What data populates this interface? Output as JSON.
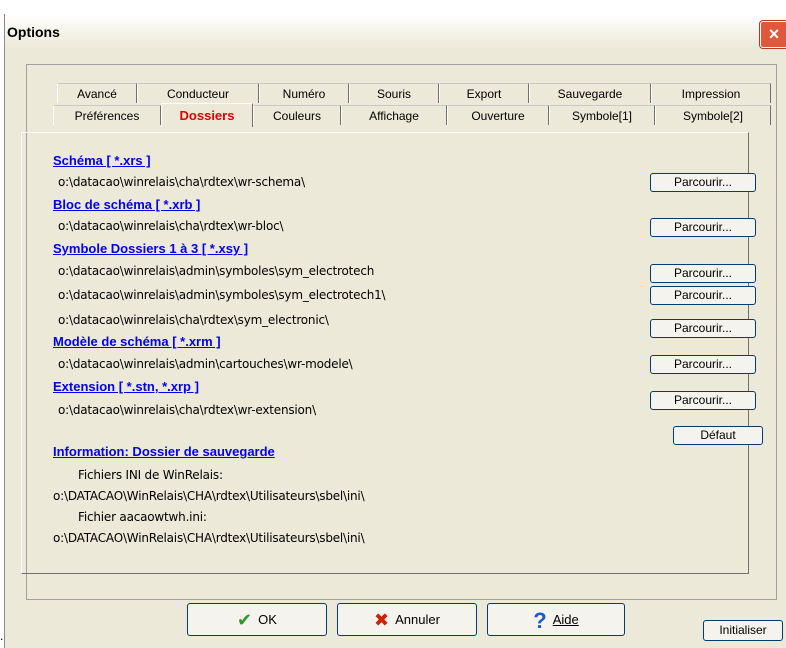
{
  "window": {
    "title": "Options",
    "close_icon": "×"
  },
  "tabs_row1": [
    "Avancé",
    "Conducteur",
    "Numéro",
    "Souris",
    "Export",
    "Sauvegarde",
    "Impression"
  ],
  "tabs_row2": [
    "Préférences",
    "Dossiers",
    "Couleurs",
    "Affichage",
    "Ouverture",
    "Symbole[1]",
    "Symbole[2]"
  ],
  "active_tab": "Dossiers",
  "sections": {
    "schema": {
      "title": "Schéma [ *.xrs ]",
      "path": "o:\\datacao\\winrelais\\cha\\rdtex\\wr-schema\\"
    },
    "bloc": {
      "title": "Bloc de schéma [ *.xrb ]",
      "path": "o:\\datacao\\winrelais\\cha\\rdtex\\wr-bloc\\"
    },
    "symbole": {
      "title": "Symbole Dossiers 1 à 3 [ *.xsy ]",
      "paths": [
        "o:\\datacao\\winrelais\\admin\\symboles\\sym_electrotech",
        "o:\\datacao\\winrelais\\admin\\symboles\\sym_electrotech1\\",
        "o:\\datacao\\winrelais\\cha\\rdtex\\sym_electronic\\"
      ]
    },
    "modele": {
      "title": "Modèle de schéma [ *.xrm ]",
      "path": "o:\\datacao\\winrelais\\admin\\cartouches\\wr-modele\\"
    },
    "extension": {
      "title": "Extension [ *.stn, *.xrp ]",
      "path": "o:\\datacao\\winrelais\\cha\\rdtex\\wr-extension\\"
    }
  },
  "browse_label": "Parcourir...",
  "default_label": "Défaut",
  "info": {
    "title": "Information: Dossier de sauvegarde",
    "ini_label": "Fichiers INI de WinRelais:",
    "ini_path": "o:\\DATACAO\\WinRelais\\CHA\\rdtex\\Utilisateurs\\sbel\\ini\\",
    "file_label": "Fichier aacaowtwh.ini:",
    "file_path": "o:\\DATACAO\\WinRelais\\CHA\\rdtex\\Utilisateurs\\sbel\\ini\\"
  },
  "buttons": {
    "ok": "OK",
    "cancel": "Annuler",
    "help": "Aide",
    "init": "Initialiser"
  },
  "icons": {
    "ok": "✔",
    "cancel": "✖",
    "help": "?"
  },
  "left_mark": ".",
  "colors": {
    "ok_icon": "#2a9a2a",
    "cancel_icon": "#cc2200",
    "help_icon": "#1a5acc",
    "active_tab": "#e00000",
    "link": "#0000ee"
  }
}
